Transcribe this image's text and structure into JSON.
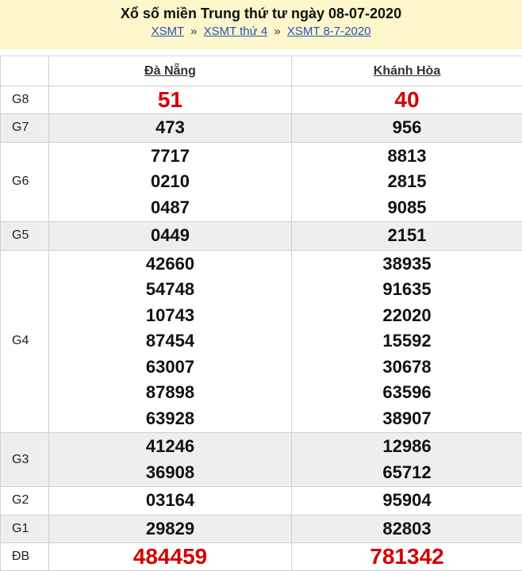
{
  "header": {
    "title": "Xổ số miền Trung thứ tư ngày 08-07-2020",
    "breadcrumbs": [
      "XSMT",
      "XSMT thứ 4",
      "XSMT 8-7-2020"
    ],
    "separator": "»"
  },
  "table": {
    "provinces": [
      "Đà Nẵng",
      "Khánh Hòa"
    ],
    "prizes": [
      {
        "label": "G8",
        "values": [
          [
            "51"
          ],
          [
            "40"
          ]
        ]
      },
      {
        "label": "G7",
        "values": [
          [
            "473"
          ],
          [
            "956"
          ]
        ]
      },
      {
        "label": "G6",
        "values": [
          [
            "7717",
            "0210",
            "0487"
          ],
          [
            "8813",
            "2815",
            "9085"
          ]
        ]
      },
      {
        "label": "G5",
        "values": [
          [
            "0449"
          ],
          [
            "2151"
          ]
        ]
      },
      {
        "label": "G4",
        "values": [
          [
            "42660",
            "54748",
            "10743",
            "87454",
            "63007",
            "87898",
            "63928"
          ],
          [
            "38935",
            "91635",
            "22020",
            "15592",
            "30678",
            "63596",
            "38907"
          ]
        ]
      },
      {
        "label": "G3",
        "values": [
          [
            "41246",
            "36908"
          ],
          [
            "12986",
            "65712"
          ]
        ]
      },
      {
        "label": "G2",
        "values": [
          [
            "03164"
          ],
          [
            "95904"
          ]
        ]
      },
      {
        "label": "G1",
        "values": [
          [
            "29829"
          ],
          [
            "82803"
          ]
        ]
      },
      {
        "label": "ĐB",
        "values": [
          [
            "484459"
          ],
          [
            "781342"
          ]
        ]
      }
    ]
  }
}
